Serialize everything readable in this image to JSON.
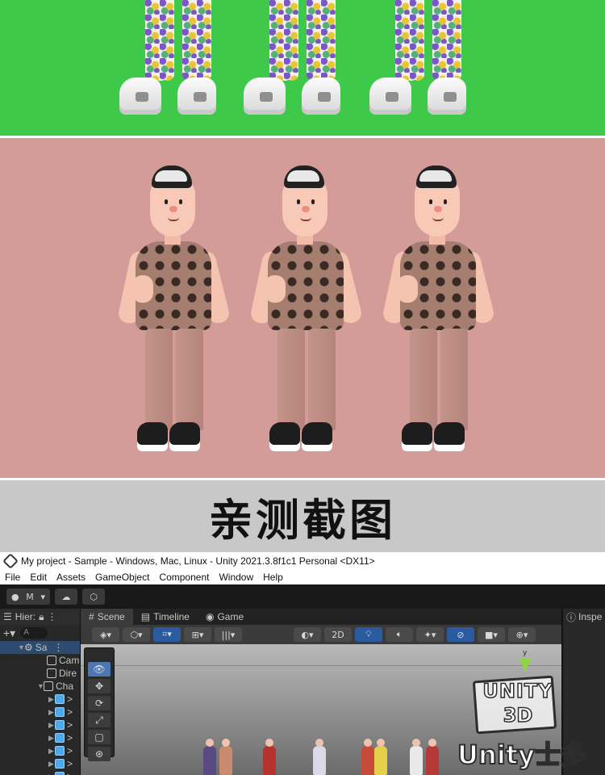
{
  "headline": "亲测截图",
  "window": {
    "title": "My project - Sample - Windows, Mac, Linux - Unity 2021.3.8f1c1 Personal <DX11>"
  },
  "menu": [
    "File",
    "Edit",
    "Assets",
    "GameObject",
    "Component",
    "Window",
    "Help"
  ],
  "toolbar": {
    "account_label": "M"
  },
  "hierarchy": {
    "tab_label": "Hier:",
    "search_placeholder": "A",
    "items": [
      {
        "label": "Sa",
        "kind": "scene"
      },
      {
        "label": "Cam",
        "kind": "object"
      },
      {
        "label": "Dire",
        "kind": "object"
      },
      {
        "label": "Cha",
        "kind": "object"
      },
      {
        "label": ">",
        "kind": "prefab"
      },
      {
        "label": ">",
        "kind": "prefab"
      },
      {
        "label": ">",
        "kind": "prefab"
      },
      {
        "label": ">",
        "kind": "prefab"
      },
      {
        "label": ">",
        "kind": "prefab"
      },
      {
        "label": ">",
        "kind": "prefab"
      },
      {
        "label": ">",
        "kind": "prefab"
      }
    ]
  },
  "scene_tabs": [
    {
      "label": "Scene",
      "active": true
    },
    {
      "label": "Timeline",
      "active": false
    },
    {
      "label": "Game",
      "active": false
    }
  ],
  "scene_toolbar": {
    "mode_2d": "2D"
  },
  "gizmo": {
    "axis_label": "y"
  },
  "inspector": {
    "tab_label": "Inspe"
  },
  "watermark": {
    "line1": "UNITY",
    "line2": "3D",
    "cn": "Unity士多"
  },
  "colors": {
    "green_bg": "#3ec94a",
    "pink_bg": "#d39c98",
    "title_band": "#c8c8c8",
    "unity_dark": "#1f1f1f"
  }
}
